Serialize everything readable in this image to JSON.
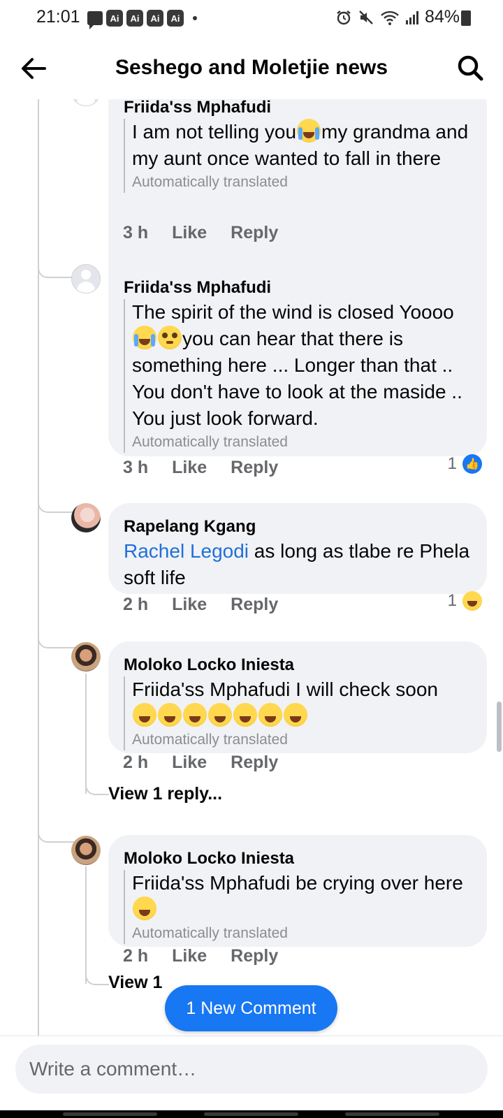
{
  "status_bar": {
    "time": "21:01",
    "ai_badges": [
      "Ai",
      "Ai",
      "Ai",
      "Ai"
    ],
    "battery": "84%"
  },
  "header": {
    "title": "Seshego and Moletjie news"
  },
  "comments": [
    {
      "author": "Friida'ss Mphafudi",
      "text_a": "I am not telling you",
      "text_b": "my grandma and my aunt once wanted to fall in there",
      "translated": "Automatically translated",
      "time": "3 h",
      "like": "Like",
      "reply": "Reply"
    },
    {
      "author": "Friida'ss Mphafudi",
      "text_a": "The spirit of the wind is closed Yoooo",
      "text_b": "you can hear that there is something here ... Longer than that .. You don't have to look at the maside .. You just look forward.",
      "translated": "Automatically translated",
      "time": "3 h",
      "like": "Like",
      "reply": "Reply",
      "reaction_count": "1",
      "reaction_icon": "like-icon"
    },
    {
      "author": "Rapelang Kgang",
      "mention": "Rachel Legodi",
      "text": " as long as tlabe  re Phela soft life",
      "time": "2 h",
      "like": "Like",
      "reply": "Reply",
      "reaction_count": "1",
      "reaction_icon": "haha-icon"
    },
    {
      "author": "Moloko Locko Iniesta",
      "text": "Friida'ss Mphafudi I will check soon",
      "translated": "Automatically translated",
      "time": "2 h",
      "like": "Like",
      "reply": "Reply",
      "view_replies": "View 1 reply..."
    },
    {
      "author": "Moloko Locko Iniesta",
      "text": "Friida'ss Mphafudi be crying over here",
      "translated": "Automatically translated",
      "time": "2 h",
      "like": "Like",
      "reply": "Reply",
      "view_replies": "View 1"
    }
  ],
  "new_comment_pill": "1 New Comment",
  "composer": {
    "placeholder": "Write a comment…"
  },
  "colors": {
    "accent": "#1877f2",
    "bubble": "#f0f2f5",
    "secondary_text": "#65676b",
    "mention": "#216fdb"
  }
}
